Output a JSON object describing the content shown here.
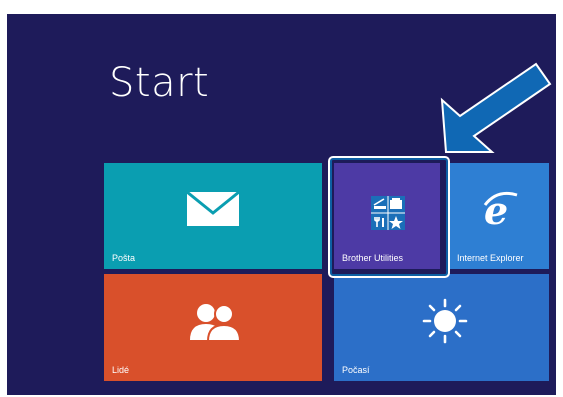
{
  "start": {
    "title": "Start"
  },
  "tiles": {
    "mail": {
      "label": "Pošta",
      "icon": "envelope-icon",
      "color": "#0a9eb1"
    },
    "people": {
      "label": "Lidé",
      "icon": "people-icon",
      "color": "#d9502b"
    },
    "brother": {
      "label": "Brother Utilities",
      "icon": "brother-utilities-icon",
      "color": "#4d3aa5"
    },
    "ie": {
      "label": "Internet Explorer",
      "icon": "internet-explorer-icon",
      "color": "#2e7fd3"
    },
    "weather": {
      "label": "Počasí",
      "icon": "sun-icon",
      "color": "#2c6fc8"
    }
  },
  "colors": {
    "background": "#1e1b5a",
    "arrow": "#1068b4",
    "highlight": "#ffffff"
  }
}
